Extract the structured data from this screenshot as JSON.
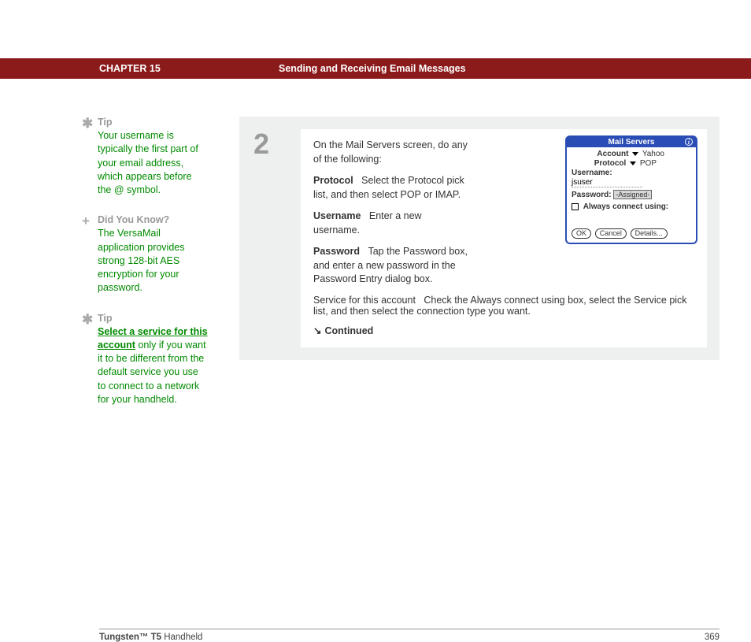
{
  "header": {
    "chapter": "CHAPTER 15",
    "title": "Sending and Receiving Email Messages"
  },
  "sidebar": {
    "tips": [
      {
        "icon": "✱",
        "heading": "Tip",
        "body": "Your username is typically the first part of your email address, which appears before the @ symbol."
      },
      {
        "icon": "+",
        "heading": "Did You Know?",
        "body": "The VersaMail application provides strong 128-bit AES encryption for your password."
      },
      {
        "icon": "✱",
        "heading": "Tip",
        "link_text": "Select a service for this account",
        "body_tail": " only if you want it to be different from the default service you use to connect to a network for your handheld."
      }
    ]
  },
  "step": {
    "number": "2",
    "intro": "On the Mail Servers screen, do any of the following:",
    "items": [
      {
        "label": "Protocol",
        "text": "Select the Protocol pick list, and then select POP or IMAP."
      },
      {
        "label": "Username",
        "text": "Enter a new username."
      },
      {
        "label": "Password",
        "text": "Tap the Password box, and enter a new password in the Password Entry dialog box."
      }
    ],
    "service": {
      "label": "Service for this account",
      "text": "Check the Always connect using box, select the Service pick list, and then select the connection type you want."
    },
    "continued": "Continued"
  },
  "screenshot": {
    "title": "Mail Servers",
    "account_label": "Account",
    "account_val": "Yahoo",
    "protocol_label": "Protocol",
    "protocol_val": "POP",
    "username_label": "Username:",
    "username_val": "jsuser",
    "password_label": "Password:",
    "password_val": "-Assigned-",
    "always_label": "Always connect using:",
    "buttons": {
      "ok": "OK",
      "cancel": "Cancel",
      "details": "Details..."
    }
  },
  "footer": {
    "product_bold": "Tungsten™ T5",
    "product_rest": " Handheld",
    "page": "369"
  }
}
